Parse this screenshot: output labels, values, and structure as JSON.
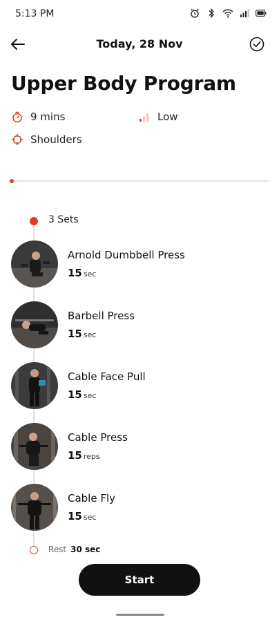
{
  "status_bar": {
    "time": "5:13 PM",
    "icons": [
      "alarm-icon",
      "bluetooth-icon",
      "wifi-icon",
      "signal-icon",
      "battery-icon"
    ]
  },
  "header": {
    "title": "Today, 28 Nov",
    "back_icon": "arrow-left-icon",
    "done_icon": "check-circle-icon"
  },
  "program": {
    "title": "Upper Body Program",
    "duration": "9 mins",
    "intensity": "Low",
    "target": "Shoulders"
  },
  "progress": {
    "fraction": 0.0
  },
  "sets_label": "3 Sets",
  "exercises": [
    {
      "name": "Arnold Dumbbell Press",
      "value": "15",
      "unit": "sec"
    },
    {
      "name": "Barbell Press",
      "value": "15",
      "unit": "sec"
    },
    {
      "name": "Cable Face Pull",
      "value": "15",
      "unit": "sec"
    },
    {
      "name": "Cable Press",
      "value": "15",
      "unit": "reps"
    },
    {
      "name": "Cable Fly",
      "value": "15",
      "unit": "sec"
    }
  ],
  "rest": {
    "label": "Rest",
    "value": "30 sec"
  },
  "start_label": "Start",
  "colors": {
    "accent": "#e53a2a",
    "button": "#111111",
    "timeline": "#e2e2e2"
  }
}
